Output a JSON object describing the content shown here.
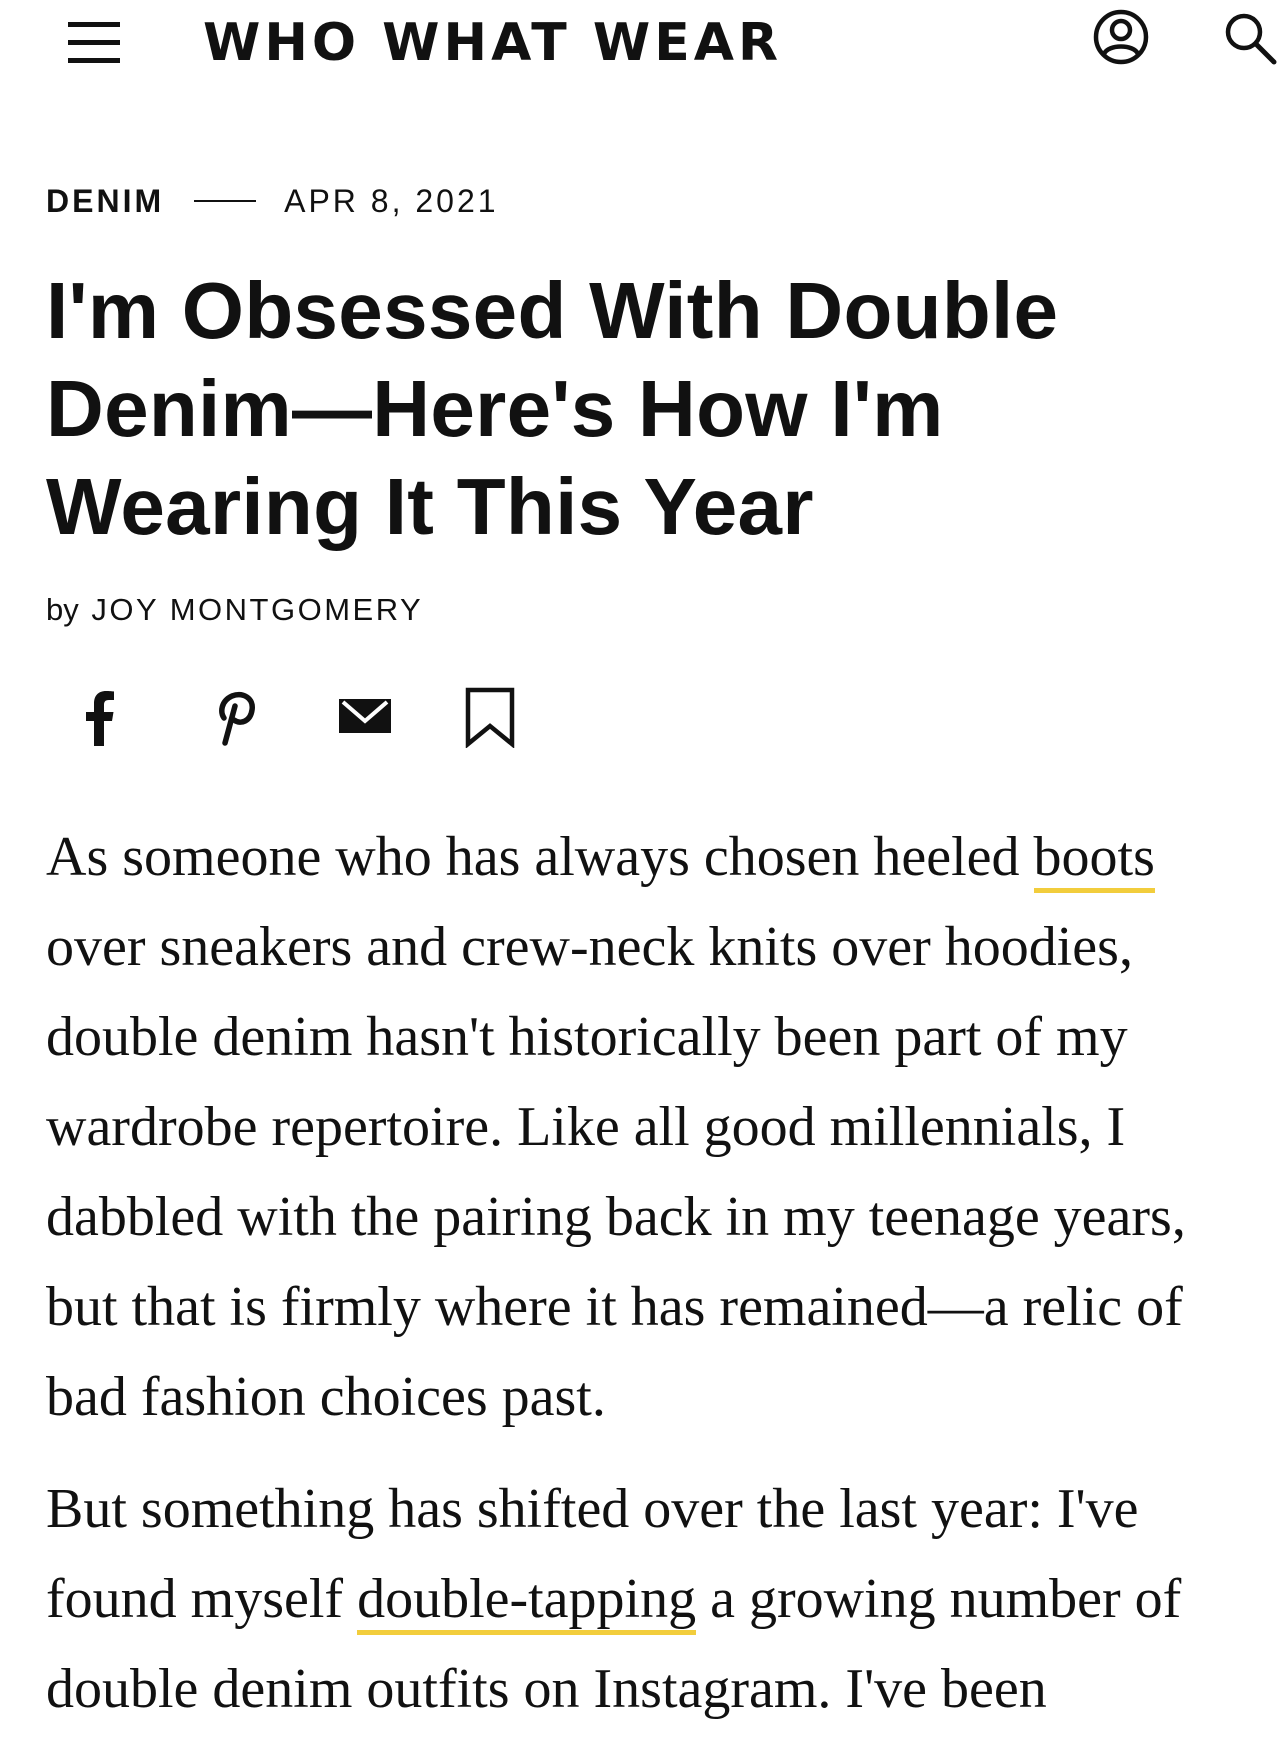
{
  "header": {
    "logo": "WHO WHAT WEAR",
    "menu_icon": "hamburger-menu-icon",
    "account_icon": "user-icon",
    "search_icon": "search-icon"
  },
  "article": {
    "category": "DENIM",
    "date": "APR 8, 2021",
    "headline": "I'm Obsessed With Double Denim—Here's How I'm Wearing It This Year",
    "byline_prefix": "by",
    "author": "JOY MONTGOMERY"
  },
  "share": {
    "icons": [
      "facebook-icon",
      "pinterest-icon",
      "email-icon",
      "bookmark-icon"
    ]
  },
  "body": {
    "p1_text_a": "As someone who has always chosen heeled ",
    "p1_link": "boots",
    "p1_text_b": " over sneakers and crew-neck knits over hoodies, double denim hasn't historically been part of my wardrobe repertoire. Like all good millennials, I dabbled with the pairing back in my teenage years, but that is firmly where it has remained—a relic of bad fashion choices past.",
    "p2_text_a": "But something has shifted over the last year: I've found myself ",
    "p2_link": "double-tapping",
    "p2_text_b": " a growing number of double denim outfits on Instagram. I've been"
  },
  "colors": {
    "text": "#111111",
    "link_underline": "#f2cd3c",
    "background": "#ffffff"
  }
}
